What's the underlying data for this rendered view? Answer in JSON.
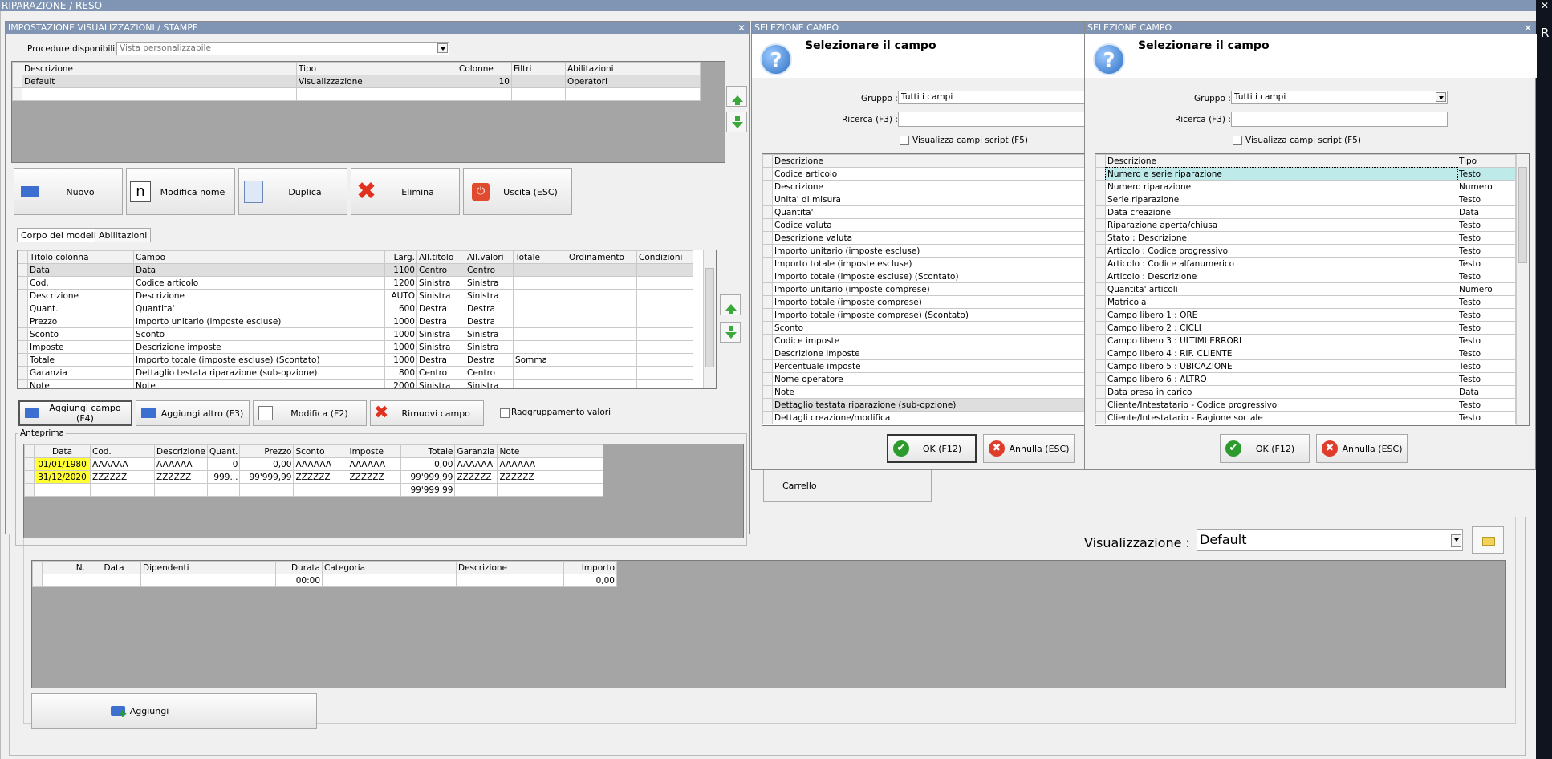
{
  "main": {
    "title": "RIPARAZIONE / RESO",
    "carrello": "Carrello",
    "visualizzazione_label": "Visualizzazione :",
    "visualizzazione_value": "Default",
    "aggiungi": "Aggiungi",
    "table": {
      "headers": [
        "N.",
        "Data",
        "Dipendenti",
        "Durata",
        "Categoria",
        "Descrizione",
        "Importo"
      ],
      "row": [
        "",
        "",
        "",
        "00:00",
        "",
        "",
        "0,00"
      ]
    }
  },
  "settings": {
    "title": "IMPOSTAZIONE VISUALIZZAZIONI / STAMPE",
    "procedure_label": "Procedure disponibili :",
    "procedure_placeholder": "Vista personalizzabile",
    "views": {
      "headers": [
        "Descrizione",
        "Tipo",
        "Colonne",
        "Filtri",
        "Abilitazioni"
      ],
      "rows": [
        [
          "Default",
          "Visualizzazione",
          "10",
          "",
          "Operatori"
        ]
      ]
    },
    "buttons": {
      "nuovo": "Nuovo",
      "modifica_nome": "Modifica nome",
      "duplica": "Duplica",
      "elimina": "Elimina",
      "uscita": "Uscita (ESC)"
    },
    "tabs": [
      "Corpo del modello",
      "Abilitazioni"
    ],
    "columns": {
      "headers": [
        "Titolo colonna",
        "Campo",
        "Larg.",
        "All.titolo",
        "All.valori",
        "Totale",
        "Ordinamento",
        "Condizioni"
      ],
      "rows": [
        [
          "Data",
          "Data",
          "1100",
          "Centro",
          "Centro",
          "",
          "",
          ""
        ],
        [
          "Cod.",
          "Codice articolo",
          "1200",
          "Sinistra",
          "Sinistra",
          "",
          "",
          ""
        ],
        [
          "Descrizione",
          "Descrizione",
          "AUTO",
          "Sinistra",
          "Sinistra",
          "",
          "",
          ""
        ],
        [
          "Quant.",
          "Quantita'",
          "600",
          "Destra",
          "Destra",
          "",
          "",
          ""
        ],
        [
          "Prezzo",
          "Importo unitario (imposte escluse)",
          "1000",
          "Destra",
          "Destra",
          "",
          "",
          ""
        ],
        [
          "Sconto",
          "Sconto",
          "1000",
          "Sinistra",
          "Sinistra",
          "",
          "",
          ""
        ],
        [
          "Imposte",
          "Descrizione imposte",
          "1000",
          "Sinistra",
          "Sinistra",
          "",
          "",
          ""
        ],
        [
          "Totale",
          "Importo totale (imposte escluse) (Scontato)",
          "1000",
          "Destra",
          "Destra",
          "Somma",
          "",
          ""
        ],
        [
          "Garanzia",
          "Dettaglio testata riparazione (sub-opzione)",
          "800",
          "Centro",
          "Centro",
          "",
          "",
          ""
        ],
        [
          "Note",
          "Note",
          "2000",
          "Sinistra",
          "Sinistra",
          "",
          "",
          ""
        ]
      ]
    },
    "buttons2": {
      "aggiungi_campo": "Aggiungi campo (F4)",
      "aggiungi_altro": "Aggiungi altro (F3)",
      "modifica": "Modifica (F2)",
      "rimuovi": "Rimuovi campo",
      "raggruppamento": "Raggruppamento valori"
    },
    "anteprima": {
      "label": "Anteprima",
      "headers": [
        "Data",
        "Cod.",
        "Descrizione",
        "Quant.",
        "Prezzo",
        "Sconto",
        "Imposte",
        "Totale",
        "Garanzia",
        "Note"
      ],
      "rows": [
        [
          "01/01/1980",
          "AAAAAA",
          "AAAAAA",
          "0",
          "0,00",
          "AAAAAA",
          "AAAAAA",
          "0,00",
          "AAAAAA",
          "AAAAAA"
        ],
        [
          "31/12/2020",
          "ZZZZZZ",
          "ZZZZZZ",
          "999...",
          "99'999,99",
          "ZZZZZZ",
          "ZZZZZZ",
          "99'999,99",
          "ZZZZZZ",
          "ZZZZZZ"
        ],
        [
          "",
          "",
          "",
          "",
          "",
          "",
          "",
          "99'999,99",
          "",
          ""
        ]
      ]
    }
  },
  "sel1": {
    "title": "SELEZIONE CAMPO",
    "heading": "Selezionare il campo",
    "gruppo_label": "Gruppo :",
    "gruppo_value": "Tutti i campi",
    "ricerca_label": "Ricerca (F3) :",
    "script_label": "Visualizza campi script (F5)",
    "header": "Descrizione",
    "items": [
      "Codice articolo",
      "Descrizione",
      "Unita' di misura",
      "Quantita'",
      "Codice valuta",
      "Descrizione valuta",
      "Importo unitario (imposte escluse)",
      "Importo totale (imposte escluse)",
      "Importo totale (imposte escluse) (Scontato)",
      "Importo unitario (imposte comprese)",
      "Importo totale (imposte comprese)",
      "Importo totale (imposte comprese) (Scontato)",
      "Sconto",
      "Codice imposte",
      "Descrizione imposte",
      "Percentuale imposte",
      "Nome operatore",
      "Note",
      "Dettaglio testata riparazione (sub-opzione)",
      "Dettagli creazione/modifica"
    ],
    "ok": "OK (F12)",
    "annulla": "Annulla (ESC)"
  },
  "sel2": {
    "title": "SELEZIONE CAMPO",
    "heading": "Selezionare il campo",
    "gruppo_label": "Gruppo :",
    "gruppo_value": "Tutti i campi",
    "ricerca_label": "Ricerca (F3) :",
    "script_label": "Visualizza campi script (F5)",
    "headers": [
      "Descrizione",
      "Tipo"
    ],
    "items": [
      [
        "Numero e serie riparazione",
        "Testo"
      ],
      [
        "Numero riparazione",
        "Numero"
      ],
      [
        "Serie riparazione",
        "Testo"
      ],
      [
        "Data creazione",
        "Data"
      ],
      [
        "Riparazione aperta/chiusa",
        "Testo"
      ],
      [
        "Stato : Descrizione",
        "Testo"
      ],
      [
        "Articolo : Codice progressivo",
        "Testo"
      ],
      [
        "Articolo : Codice alfanumerico",
        "Testo"
      ],
      [
        "Articolo : Descrizione",
        "Testo"
      ],
      [
        "Quantita' articoli",
        "Numero"
      ],
      [
        "Matricola",
        "Testo"
      ],
      [
        "Campo libero 1 : ORE",
        "Testo"
      ],
      [
        "Campo libero 2 : CICLI",
        "Testo"
      ],
      [
        "Campo libero 3 : ULTIMI ERRORI",
        "Testo"
      ],
      [
        "Campo libero 4 : RIF. CLIENTE",
        "Testo"
      ],
      [
        "Campo libero 5 : UBICAZIONE",
        "Testo"
      ],
      [
        "Campo libero 6 : ALTRO",
        "Testo"
      ],
      [
        "Data presa in carico",
        "Data"
      ],
      [
        "Cliente/Intestatario - Codice progressivo",
        "Testo"
      ],
      [
        "Cliente/Intestatario - Ragione sociale",
        "Testo"
      ]
    ],
    "ok": "OK (F12)",
    "annulla": "Annulla (ESC)"
  },
  "edge_text": "R"
}
